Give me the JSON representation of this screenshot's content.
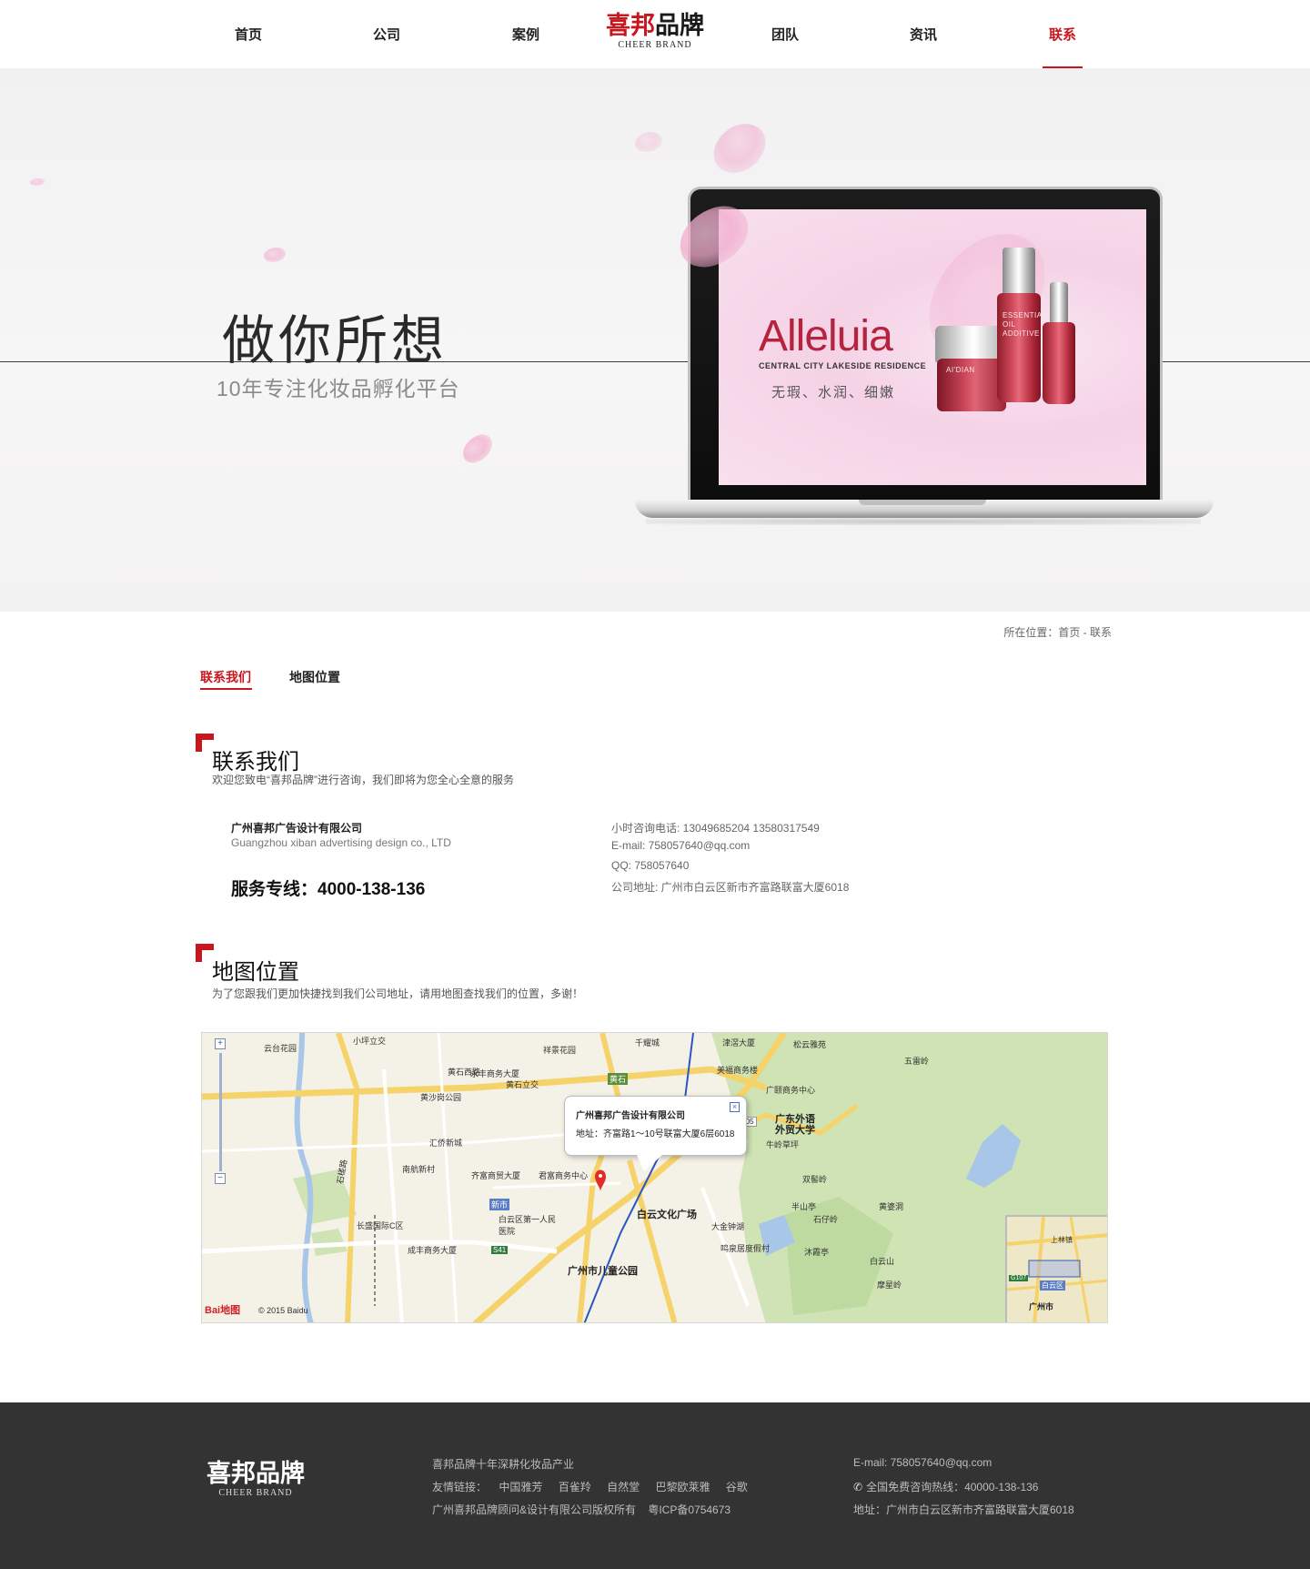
{
  "nav": {
    "items": [
      "首页",
      "公司",
      "案例",
      "团队",
      "资讯",
      "联系"
    ],
    "active": "联系"
  },
  "logo": {
    "cn_a": "喜邦",
    "cn_b": "品牌",
    "en": "CHEER BRAND"
  },
  "banner": {
    "title": "做你所想",
    "subtitle": "10年专注化妆品孵化平台",
    "screen": {
      "brand": "Alleluia",
      "brand_sub": "CENTRAL CITY LAKESIDE RESIDENCE",
      "tagline": "无瑕、水润、细嫩",
      "product_label": "AI'DIAN",
      "product_desc": "ESSENTIAL OIL ADDITIVE"
    }
  },
  "breadcrumb": "所在位置：首页 - 联系",
  "tabs": [
    "联系我们",
    "地图位置"
  ],
  "contact": {
    "title": "联系我们",
    "desc": "欢迎您致电“喜邦品牌”进行咨询，我们即将为您全心全意的服务",
    "company": "广州喜邦广告设计有限公司",
    "company_en": "Guangzhou xiban advertising design co., LTD",
    "hotline": "服务专线：4000-138-136",
    "phone": "小时咨询电话: 13049685204 13580317549",
    "email": "E-mail: 758057640@qq.com",
    "qq": "QQ: 758057640",
    "address": "公司地址: 广州市白云区新市齐富路联富大厦6018"
  },
  "map_section": {
    "title": "地图位置",
    "desc": "为了您跟我们更加快捷找到我们公司地址，请用地图查找我们的位置，多谢！",
    "popup_title": "广州喜邦广告设计有限公司",
    "popup_address": "地址：齐富路1～10号联富大厦6层6018",
    "popup_close": "×",
    "labels": {
      "l1": "小坪立交",
      "l2": "黄石西路",
      "l3": "黄石立交",
      "l4": "黄石",
      "l5": "广东外语",
      "l6": "外贸大学",
      "l7": "白云文化广场",
      "l8": "广州市儿童公园",
      "l9": "新市",
      "l10": "广州市",
      "l11": "白云区",
      "l12": "上林镇",
      "l13": "君富商务中心",
      "l14": "齐富商贸大厦",
      "l15": "白云区第一人民医院",
      "l16": "云台花园",
      "l17": "石槎路",
      "l18": "永丰商务大厦",
      "l19": "黄沙岗公园",
      "l20": "汇侨新城",
      "l21": "南航新村",
      "l22": "长盛国际C区",
      "l23": "成丰商务大厦",
      "l24": "祥景花园",
      "l25": "千耀城",
      "l26": "津滘大厦",
      "l27": "松云雅苑",
      "l28": "五雷岭",
      "l29": "美福商务楼",
      "l30": "广颐商务中心",
      "l31": "牛岭草坪",
      "l32": "双髻岭",
      "l33": "半山亭",
      "l34": "石仔岭",
      "l35": "沐霞亭",
      "l36": "白云山",
      "l37": "摩星岭",
      "l38": "黄婆洞",
      "l39": "大金钟湖",
      "l40": "鸣泉居度假村"
    },
    "road_tags": [
      "G105",
      "S41",
      "G107"
    ],
    "zoom": [
      "+",
      "−"
    ],
    "baidu": "Bai地图",
    "copyright": "© 2015 Baidu"
  },
  "footer": {
    "slogan": "喜邦品牌十年深耕化妆品产业",
    "links_label": "友情链接：",
    "links": [
      "中国雅芳",
      "百雀羚",
      "自然堂",
      "巴黎欧莱雅",
      "谷歌"
    ],
    "copyright": "广州喜邦品牌顾问&设计有限公司版权所有    粤ICP备0754673",
    "email": "E-mail: 758057640@qq.com",
    "hotline": "全国免费咨询热线：40000-138-136",
    "address": "地址：广州市白云区新市齐富路联富大厦6018"
  },
  "colors": {
    "accent": "#c8161e",
    "footer_bg": "#333333",
    "banner_bg": "#f4f3f3"
  }
}
